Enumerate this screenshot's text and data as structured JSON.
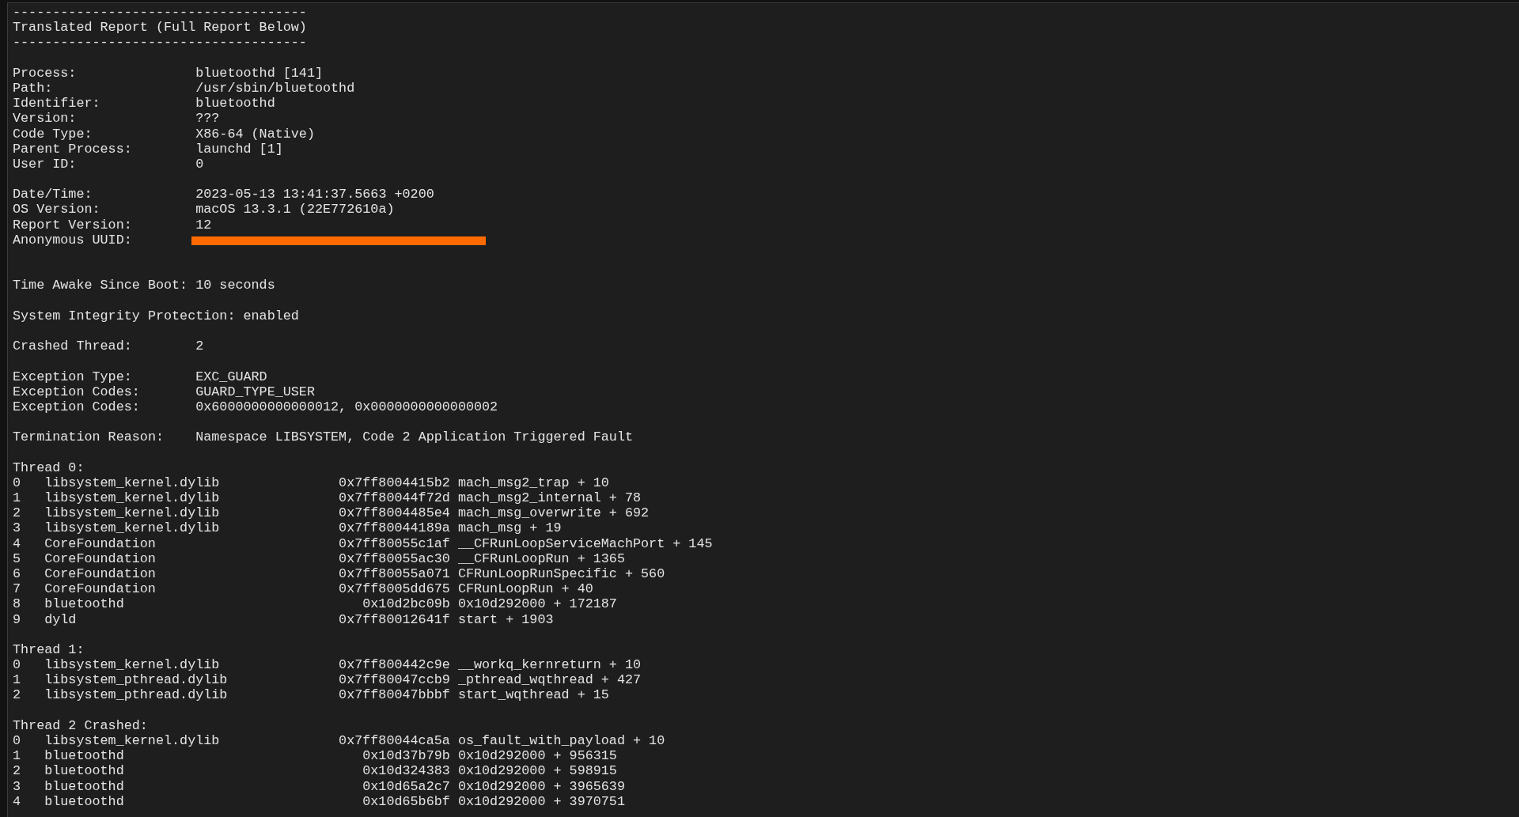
{
  "header": {
    "divider_top": "-------------------------------------",
    "title": "Translated Report (Full Report Below)",
    "divider_bottom": "-------------------------------------"
  },
  "sections": [
    {
      "kind": "fields",
      "fields": [
        {
          "label": "Process:",
          "value": "bluetoothd [141]"
        },
        {
          "label": "Path:",
          "value": "/usr/sbin/bluetoothd"
        },
        {
          "label": "Identifier:",
          "value": "bluetoothd"
        },
        {
          "label": "Version:",
          "value": "???"
        },
        {
          "label": "Code Type:",
          "value": "X86-64 (Native)"
        },
        {
          "label": "Parent Process:",
          "value": "launchd [1]"
        },
        {
          "label": "User ID:",
          "value": "0"
        }
      ]
    },
    {
      "kind": "fields",
      "fields": [
        {
          "label": "Date/Time:",
          "value": "2023-05-13 13:41:37.5663 +0200"
        },
        {
          "label": "OS Version:",
          "value": "macOS 13.3.1 (22E772610a)"
        },
        {
          "label": "Report Version:",
          "value": "12"
        },
        {
          "label": "Anonymous UUID:",
          "redacted": true
        }
      ]
    },
    {
      "kind": "line",
      "text": "Time Awake Since Boot: 10 seconds"
    },
    {
      "kind": "line",
      "text": "System Integrity Protection: enabled"
    },
    {
      "kind": "fields",
      "fields": [
        {
          "label": "Crashed Thread:",
          "value": "2"
        }
      ]
    },
    {
      "kind": "fields",
      "fields": [
        {
          "label": "Exception Type:",
          "value": "EXC_GUARD"
        },
        {
          "label": "Exception Codes:",
          "value": "GUARD_TYPE_USER"
        },
        {
          "label": "Exception Codes:",
          "value": "0x6000000000000012, 0x0000000000000002"
        }
      ]
    },
    {
      "kind": "fields",
      "fields": [
        {
          "label": "Termination Reason:",
          "value": "Namespace LIBSYSTEM, Code 2 Application Triggered Fault"
        }
      ]
    },
    {
      "kind": "thread",
      "title": "Thread 0:",
      "frames": [
        {
          "index": "0",
          "library": "libsystem_kernel.dylib",
          "address": "0x7ff8004415b2",
          "symbol": "mach_msg2_trap + 10"
        },
        {
          "index": "1",
          "library": "libsystem_kernel.dylib",
          "address": "0x7ff80044f72d",
          "symbol": "mach_msg2_internal + 78"
        },
        {
          "index": "2",
          "library": "libsystem_kernel.dylib",
          "address": "0x7ff8004485e4",
          "symbol": "mach_msg_overwrite + 692"
        },
        {
          "index": "3",
          "library": "libsystem_kernel.dylib",
          "address": "0x7ff80044189a",
          "symbol": "mach_msg + 19"
        },
        {
          "index": "4",
          "library": "CoreFoundation",
          "address": "0x7ff80055c1af",
          "symbol": "__CFRunLoopServiceMachPort + 145"
        },
        {
          "index": "5",
          "library": "CoreFoundation",
          "address": "0x7ff80055ac30",
          "symbol": "__CFRunLoopRun + 1365"
        },
        {
          "index": "6",
          "library": "CoreFoundation",
          "address": "0x7ff80055a071",
          "symbol": "CFRunLoopRunSpecific + 560"
        },
        {
          "index": "7",
          "library": "CoreFoundation",
          "address": "0x7ff8005dd675",
          "symbol": "CFRunLoopRun + 40"
        },
        {
          "index": "8",
          "library": "bluetoothd",
          "address": "0x10d2bc09b",
          "symbol": "0x10d292000 + 172187"
        },
        {
          "index": "9",
          "library": "dyld",
          "address": "0x7ff80012641f",
          "symbol": "start + 1903"
        }
      ]
    },
    {
      "kind": "thread",
      "title": "Thread 1:",
      "frames": [
        {
          "index": "0",
          "library": "libsystem_kernel.dylib",
          "address": "0x7ff800442c9e",
          "symbol": "__workq_kernreturn + 10"
        },
        {
          "index": "1",
          "library": "libsystem_pthread.dylib",
          "address": "0x7ff80047ccb9",
          "symbol": "_pthread_wqthread + 427"
        },
        {
          "index": "2",
          "library": "libsystem_pthread.dylib",
          "address": "0x7ff80047bbbf",
          "symbol": "start_wqthread + 15"
        }
      ]
    },
    {
      "kind": "thread",
      "title": "Thread 2 Crashed:",
      "frames": [
        {
          "index": "0",
          "library": "libsystem_kernel.dylib",
          "address": "0x7ff80044ca5a",
          "symbol": "os_fault_with_payload + 10"
        },
        {
          "index": "1",
          "library": "bluetoothd",
          "address": "0x10d37b79b",
          "symbol": "0x10d292000 + 956315"
        },
        {
          "index": "2",
          "library": "bluetoothd",
          "address": "0x10d324383",
          "symbol": "0x10d292000 + 598915"
        },
        {
          "index": "3",
          "library": "bluetoothd",
          "address": "0x10d65a2c7",
          "symbol": "0x10d292000 + 3965639"
        },
        {
          "index": "4",
          "library": "bluetoothd",
          "address": "0x10d65b6bf",
          "symbol": "0x10d292000 + 3970751"
        }
      ]
    }
  ]
}
